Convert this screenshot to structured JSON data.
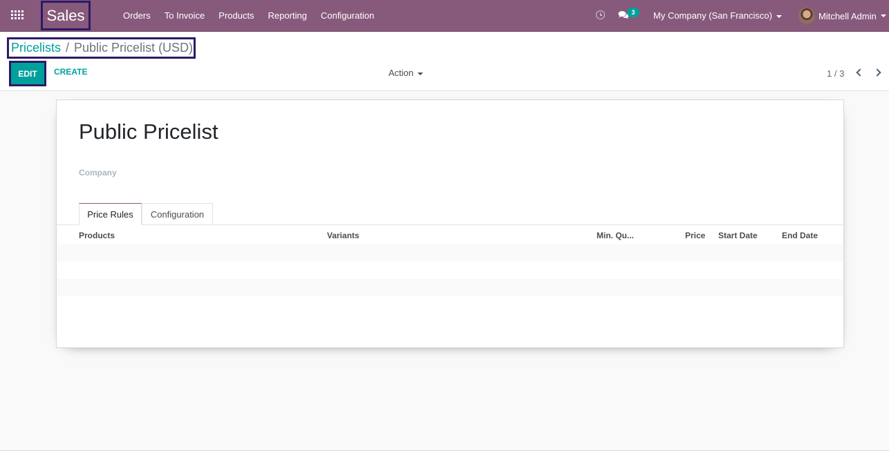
{
  "navbar": {
    "app_name": "Sales",
    "menu": [
      "Orders",
      "To Invoice",
      "Products",
      "Reporting",
      "Configuration"
    ],
    "icons": {
      "apps": "grid-icon",
      "activity": "clock-icon",
      "messages": "chat-icon"
    },
    "message_count": "3",
    "company": "My Company (San Francisco)",
    "user": "Mitchell Admin",
    "colors": {
      "brand": "#875a7b",
      "accent": "#00a09d"
    }
  },
  "control_panel": {
    "breadcrumb": {
      "parent": "Pricelists",
      "separator": "/",
      "current": "Public Pricelist (USD)"
    },
    "edit_label": "EDIT",
    "create_label": "CREATE",
    "action_label": "Action",
    "pager": "1 / 3"
  },
  "form": {
    "title": "Public Pricelist",
    "company_label": "Company",
    "tabs": [
      {
        "label": "Price Rules",
        "active": true
      },
      {
        "label": "Configuration",
        "active": false
      }
    ],
    "columns": [
      "Products",
      "Variants",
      "Min. Qu...",
      "Price",
      "Start Date",
      "End Date"
    ],
    "rows": []
  }
}
